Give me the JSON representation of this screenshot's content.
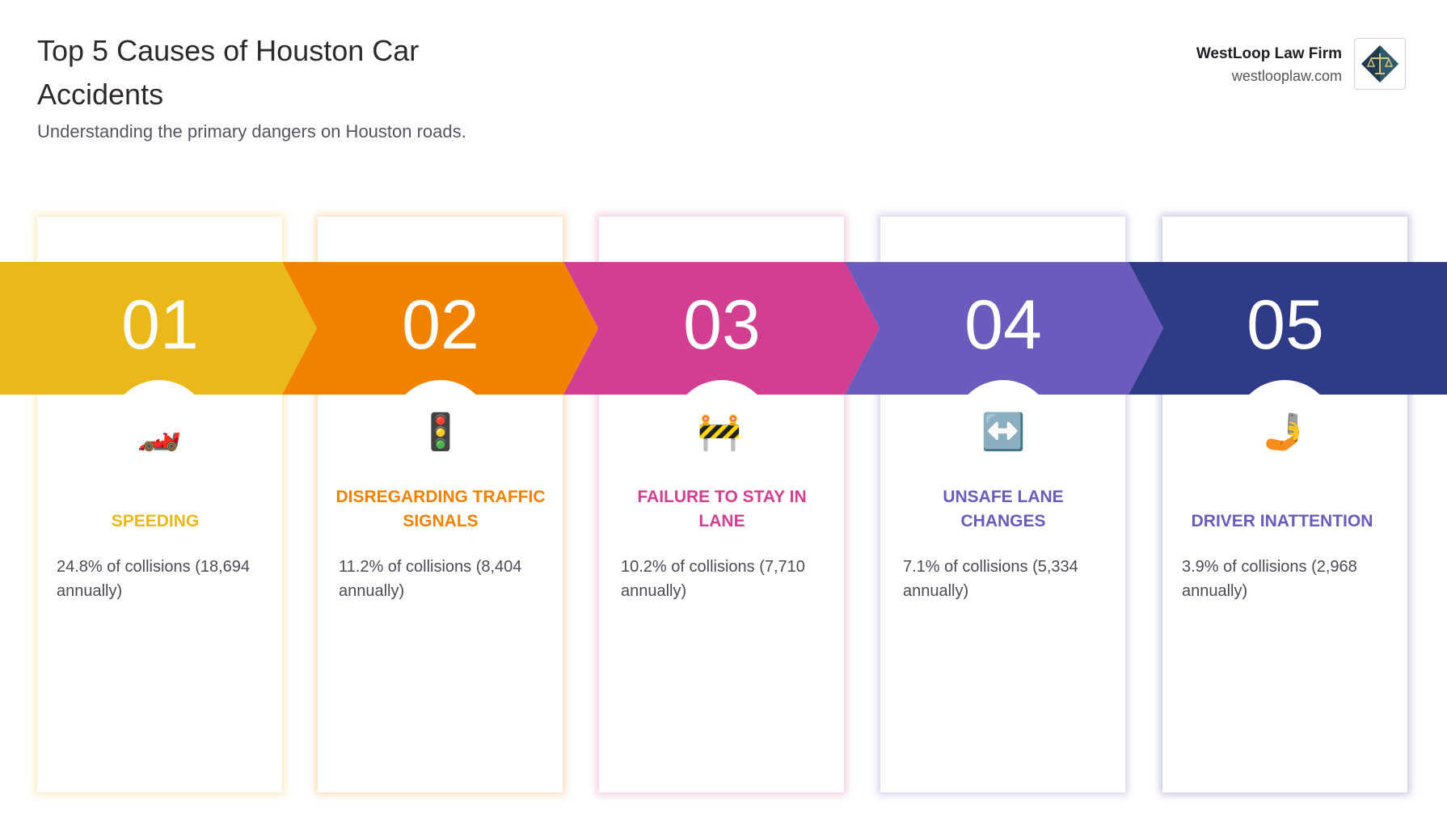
{
  "header": {
    "title": "Top 5 Causes of Houston Car Accidents",
    "subtitle": "Understanding the primary dangers on Houston roads."
  },
  "brand": {
    "name": "WestLoop Law Firm",
    "site": "westlooplaw.com",
    "logo_icon": "scales-of-justice-icon"
  },
  "causes": [
    {
      "number": "01",
      "title": "SPEEDING",
      "description": "24.8% of collisions (18,694 annually)",
      "icon": "🏎️",
      "icon_name": "race-car-icon",
      "color": "#ebb819",
      "percent": 24.8,
      "annual": 18694
    },
    {
      "number": "02",
      "title": "DISREGARDING TRAFFIC SIGNALS",
      "description": "11.2% of collisions (8,404 annually)",
      "icon": "🚦",
      "icon_name": "traffic-light-icon",
      "color": "#f18200",
      "percent": 11.2,
      "annual": 8404
    },
    {
      "number": "03",
      "title": "FAILURE TO STAY IN LANE",
      "description": "10.2% of collisions (7,710 annually)",
      "icon": "🚧",
      "icon_name": "construction-barrier-icon",
      "color": "#d23f91",
      "percent": 10.2,
      "annual": 7710
    },
    {
      "number": "04",
      "title": "UNSAFE LANE CHANGES",
      "description": "7.1% of collisions (5,334 annually)",
      "icon": "↔️",
      "icon_name": "left-right-arrow-icon",
      "color": "#6c5bbd",
      "percent": 7.1,
      "annual": 5334
    },
    {
      "number": "05",
      "title": "DRIVER INATTENTION",
      "description": "3.9% of collisions (2,968 annually)",
      "icon": "🤳",
      "icon_name": "selfie-phone-icon",
      "color": "#2f3a88",
      "percent": 3.9,
      "annual": 2968
    }
  ]
}
